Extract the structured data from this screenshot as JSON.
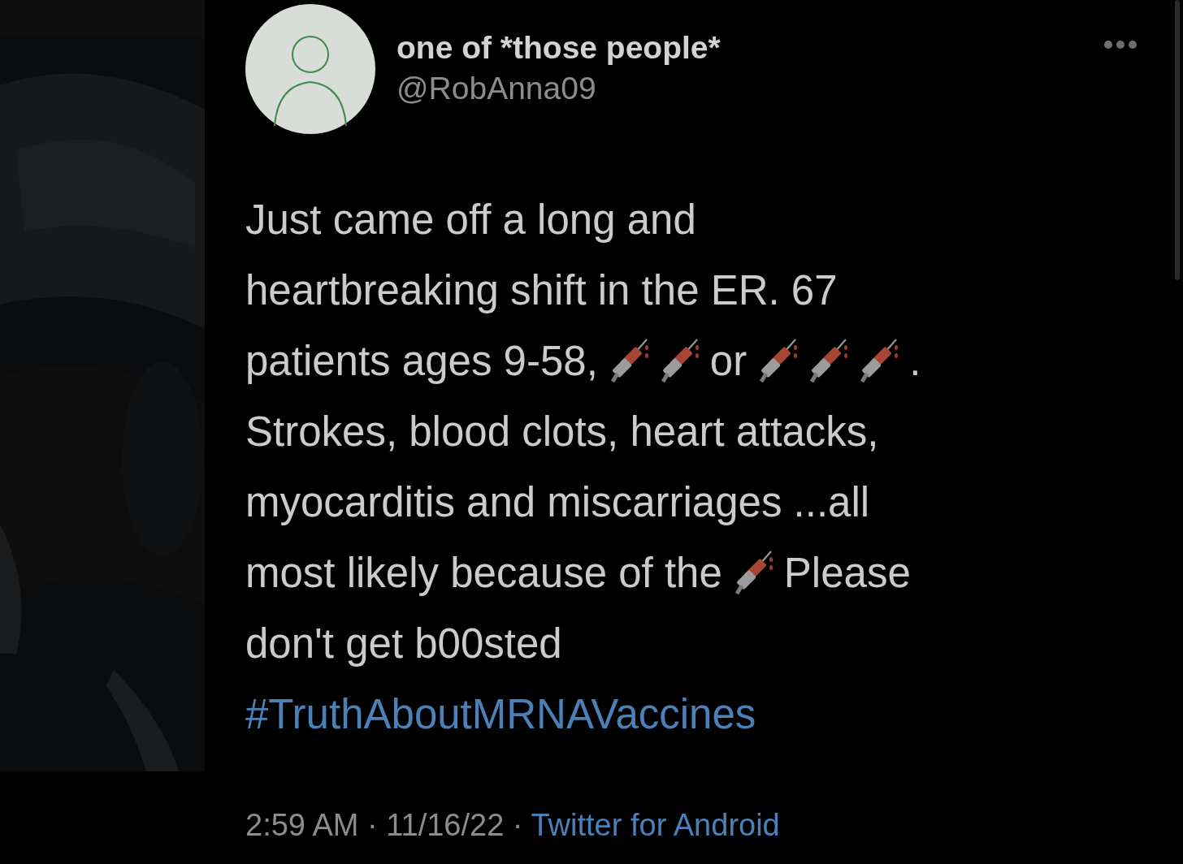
{
  "author": {
    "name": "one of *those people*",
    "handle": "@RobAnna09"
  },
  "body": [
    [
      {
        "kind": "text",
        "text": "Just came off a long and"
      }
    ],
    [
      {
        "kind": "text",
        "text": "heartbreaking shift in the ER. 67"
      }
    ],
    [
      {
        "kind": "text",
        "text": "patients ages 9-58,"
      },
      {
        "kind": "syringe"
      },
      {
        "kind": "syringe"
      },
      {
        "kind": "text",
        "text": "or"
      },
      {
        "kind": "syringe"
      },
      {
        "kind": "syringe"
      },
      {
        "kind": "syringe"
      },
      {
        "kind": "text",
        "text": "."
      }
    ],
    [
      {
        "kind": "text",
        "text": "Strokes, blood clots, heart attacks,"
      }
    ],
    [
      {
        "kind": "text",
        "text": "myocarditis and miscarriages ...all"
      }
    ],
    [
      {
        "kind": "text",
        "text": "most likely because of the"
      },
      {
        "kind": "syringe"
      },
      {
        "kind": "text",
        "text": "Please"
      }
    ],
    [
      {
        "kind": "text",
        "text": "don't get b00sted"
      }
    ],
    [
      {
        "kind": "hashtag",
        "text": "#TruthAboutMRNAVaccines"
      }
    ]
  ],
  "footer": {
    "meta": "2:59 AM · 11/16/22 ·",
    "source": "Twitter for Android"
  }
}
